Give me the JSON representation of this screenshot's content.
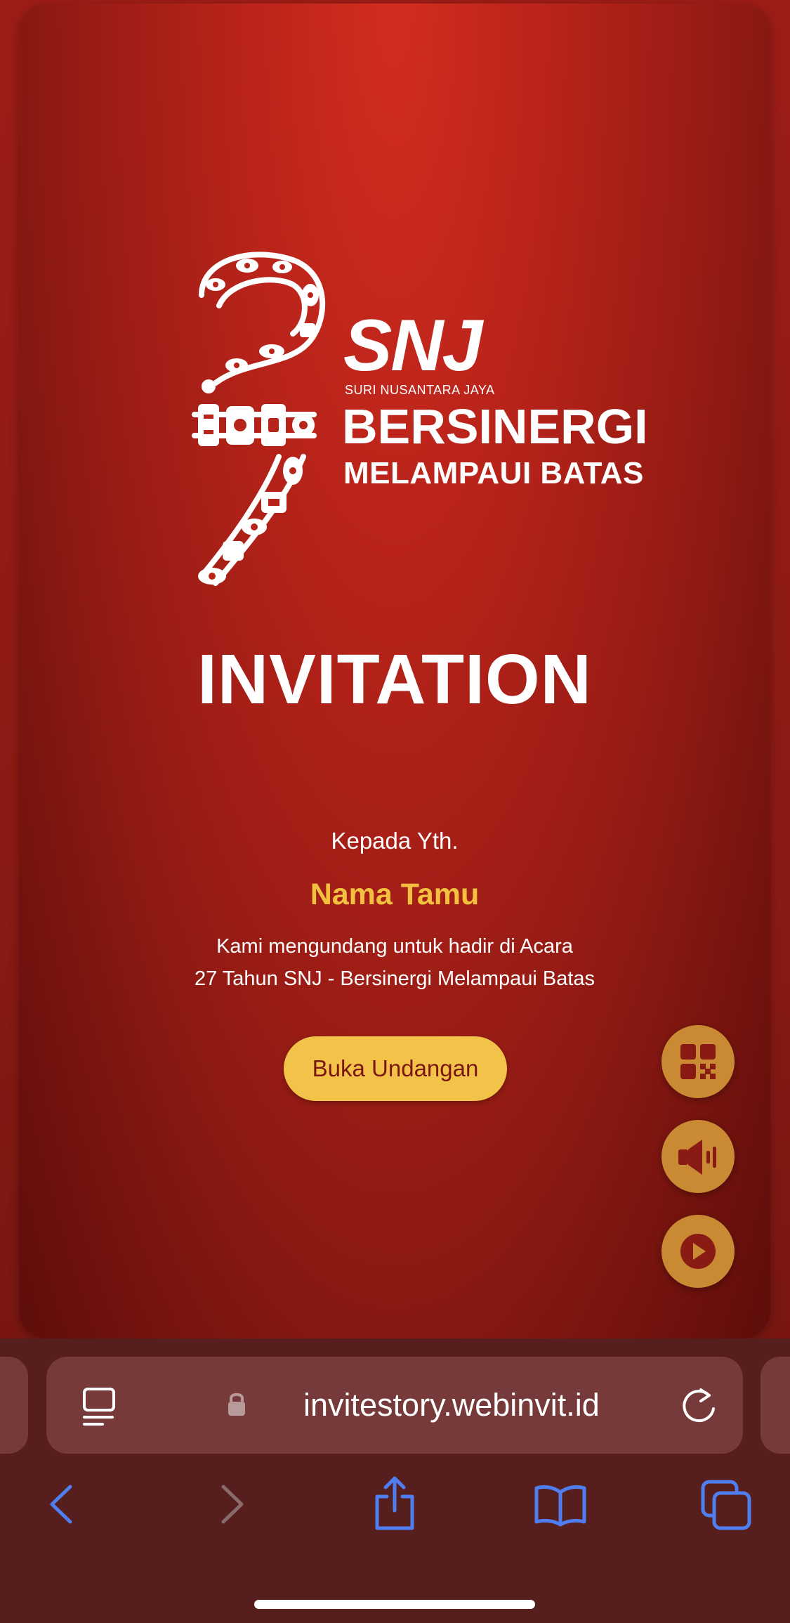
{
  "card": {
    "brand_logo": "SNJ",
    "company_name": "SURI NUSANTARA JAYA",
    "tagline_line1": "BERSINERGI",
    "tagline_line2": "MELAMPAUI BATAS",
    "headline": "INVITATION",
    "greeting": "Kepada Yth.",
    "guest_name": "Nama Tamu",
    "invite_line_1": "Kami mengundang untuk hadir di Acara",
    "invite_line_2": "27 Tahun SNJ - Bersinergi Melampaui Batas",
    "open_button_label": "Buka Undangan",
    "floating_buttons": [
      "qr-code-icon",
      "speaker-icon",
      "play-icon"
    ]
  },
  "browser": {
    "url": "invitestory.webinvit.id",
    "left_icon": "reader-icon",
    "lock_icon": "lock-icon",
    "reload_icon": "reload-icon",
    "toolbar": [
      "back-icon",
      "forward-icon",
      "share-icon",
      "bookmarks-icon",
      "tabs-icon"
    ]
  },
  "colors": {
    "card_red": "#b8231a",
    "gold_text": "#f3c13f",
    "button_gold": "#f2c348",
    "fab_gold": "#c98a33",
    "safari_bar": "#571e1e",
    "address_pill": "#773a3a",
    "ios_blue": "#4f7ef0"
  }
}
